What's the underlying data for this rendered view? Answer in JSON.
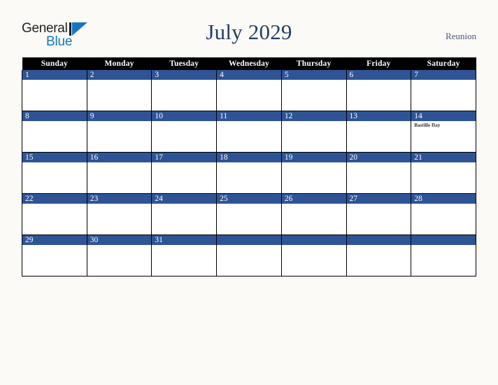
{
  "brand": {
    "word_one": "General",
    "word_two": "Blue",
    "triangle_icon": "triangle-right-icon",
    "accent_color": "#1477c4",
    "text_color": "#231f20"
  },
  "header": {
    "title": "July 2029",
    "region": "Reunion",
    "title_color": "#243d66",
    "region_color": "#4a5875"
  },
  "calendar": {
    "month": "July",
    "year": "2029",
    "header_bg": "#000000",
    "header_fg": "#ffffff",
    "daynum_bg": "#2f5496",
    "daynum_fg": "#ffffff",
    "cell_bg": "#ffffff",
    "border_color": "#000000",
    "weekdays": [
      "Sunday",
      "Monday",
      "Tuesday",
      "Wednesday",
      "Thursday",
      "Friday",
      "Saturday"
    ],
    "weeks": [
      [
        {
          "day": "1",
          "events": []
        },
        {
          "day": "2",
          "events": []
        },
        {
          "day": "3",
          "events": []
        },
        {
          "day": "4",
          "events": []
        },
        {
          "day": "5",
          "events": []
        },
        {
          "day": "6",
          "events": []
        },
        {
          "day": "7",
          "events": []
        }
      ],
      [
        {
          "day": "8",
          "events": []
        },
        {
          "day": "9",
          "events": []
        },
        {
          "day": "10",
          "events": []
        },
        {
          "day": "11",
          "events": []
        },
        {
          "day": "12",
          "events": []
        },
        {
          "day": "13",
          "events": []
        },
        {
          "day": "14",
          "events": [
            "Bastille Day"
          ]
        }
      ],
      [
        {
          "day": "15",
          "events": []
        },
        {
          "day": "16",
          "events": []
        },
        {
          "day": "17",
          "events": []
        },
        {
          "day": "18",
          "events": []
        },
        {
          "day": "19",
          "events": []
        },
        {
          "day": "20",
          "events": []
        },
        {
          "day": "21",
          "events": []
        }
      ],
      [
        {
          "day": "22",
          "events": []
        },
        {
          "day": "23",
          "events": []
        },
        {
          "day": "24",
          "events": []
        },
        {
          "day": "25",
          "events": []
        },
        {
          "day": "26",
          "events": []
        },
        {
          "day": "27",
          "events": []
        },
        {
          "day": "28",
          "events": []
        }
      ],
      [
        {
          "day": "29",
          "events": []
        },
        {
          "day": "30",
          "events": []
        },
        {
          "day": "31",
          "events": []
        },
        {
          "day": "",
          "events": []
        },
        {
          "day": "",
          "events": []
        },
        {
          "day": "",
          "events": []
        },
        {
          "day": "",
          "events": []
        }
      ]
    ]
  }
}
